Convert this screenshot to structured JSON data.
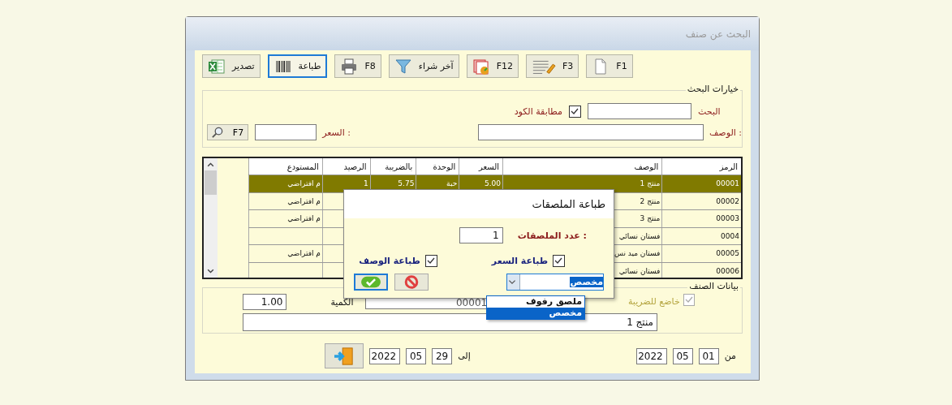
{
  "window": {
    "title": "البحث عن صنف"
  },
  "toolbar": [
    {
      "kind": "document",
      "label": "F1",
      "selected": false
    },
    {
      "kind": "list",
      "label": "F3",
      "selected": false
    },
    {
      "kind": "calendar",
      "label": "F12",
      "selected": false
    },
    {
      "kind": "filter",
      "label": "آخر شراء",
      "selected": false
    },
    {
      "kind": "printer",
      "label": "F8",
      "selected": false
    },
    {
      "kind": "barcode",
      "label": "طباعة",
      "selected": true
    },
    {
      "kind": "export",
      "label": "تصدير",
      "selected": false
    }
  ],
  "search_options": {
    "legend": "خيارات البحث",
    "search_label": "البحث",
    "code_match": {
      "label": "مطابقة الكود",
      "checked": true
    },
    "description_label": "الوصف :",
    "price_label": "السعر :",
    "search_button": "F7"
  },
  "table": {
    "columns": [
      "الرمز",
      "الوصف",
      "السعر",
      "الوحدة",
      "بالضريبة",
      "الرصيد",
      "المستودع"
    ],
    "rows": [
      {
        "selected": true,
        "code": "00001",
        "description": "منتج 1",
        "price": "5.00",
        "unit": "حبة",
        "price_with_tax": "5.75",
        "balance": "1",
        "warehouse": "م افتراضي"
      },
      {
        "selected": false,
        "code": "00002",
        "description": "منتج 2",
        "warehouse": "م افتراضي"
      },
      {
        "selected": false,
        "code": "00003",
        "description": "منتج 3",
        "warehouse": "م افتراضي"
      },
      {
        "selected": false,
        "code": "0004",
        "description": "فستان نسائي"
      },
      {
        "selected": false,
        "code": "00005",
        "description": "فستان ميد نس",
        "warehouse": "م افتراضي"
      },
      {
        "selected": false,
        "code": "00006",
        "description": "فستان نسائي"
      }
    ]
  },
  "item_data": {
    "legend": "بيانات الصنف",
    "taxable": {
      "label": "خاضع للضريبة",
      "checked": true,
      "disabled": true
    },
    "code": "00001",
    "quantity_label": "الكمية",
    "quantity": "1.00",
    "name": "منتج 1"
  },
  "date_range": {
    "from_label": "من",
    "from": [
      "01",
      "05",
      "2022"
    ],
    "to_label": "إلى",
    "to": [
      "29",
      "05",
      "2022"
    ]
  },
  "dialog": {
    "title": "طباعة الملصقات",
    "count_label": "عدد الملصقات :",
    "count": "1",
    "checks": [
      {
        "label": "طباعة السعر",
        "checked": true
      },
      {
        "label": "طباعة الوصف",
        "checked": true
      }
    ],
    "combo": {
      "value": "مخصص",
      "options": [
        {
          "label": "ملصق رفوف",
          "selected": false
        },
        {
          "label": "مخصص",
          "selected": true
        }
      ]
    }
  }
}
